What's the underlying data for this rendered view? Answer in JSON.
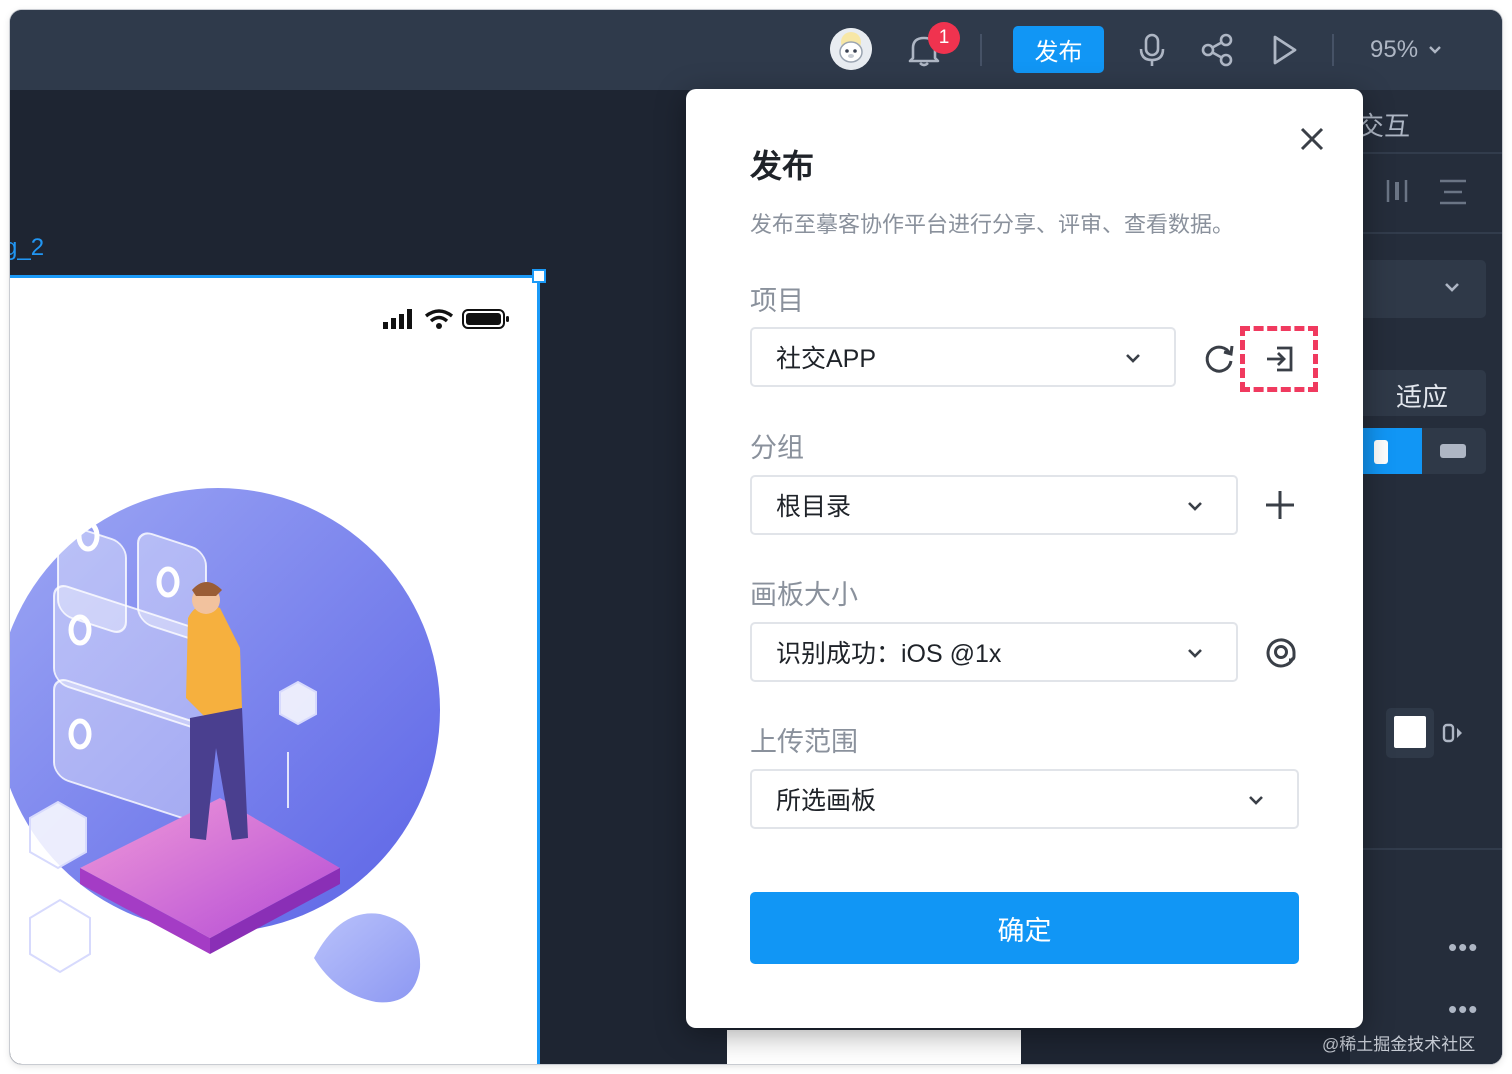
{
  "topbar": {
    "notification_count": "1",
    "publish_label": "发布",
    "zoom_value": "95%"
  },
  "canvas": {
    "board_label": "g_2"
  },
  "right_panel": {
    "interaction_label": "交互",
    "fit_label": "适应"
  },
  "dialog": {
    "title": "发布",
    "description": "发布至摹客协作平台进行分享、评审、查看数据。",
    "project_label": "项目",
    "project_value": "社交APP",
    "group_label": "分组",
    "group_value": "根目录",
    "board_size_label": "画板大小",
    "board_size_value": "识别成功：iOS @1x",
    "upload_scope_label": "上传范围",
    "upload_scope_value": "所选画板",
    "confirm_label": "确定"
  },
  "watermark": "@稀土掘金技术社区",
  "colors": {
    "accent": "#1196f5",
    "badge": "#f0334f",
    "highlight": "#f03a5f",
    "topbar": "#2f3a4b",
    "canvas": "#1e2532"
  },
  "icons": [
    "avatar-icon",
    "bell-icon",
    "microphone-icon",
    "share-icon",
    "play-icon",
    "close-icon",
    "refresh-icon",
    "import-icon",
    "plus-icon",
    "target-icon",
    "chevron-down-icon"
  ]
}
